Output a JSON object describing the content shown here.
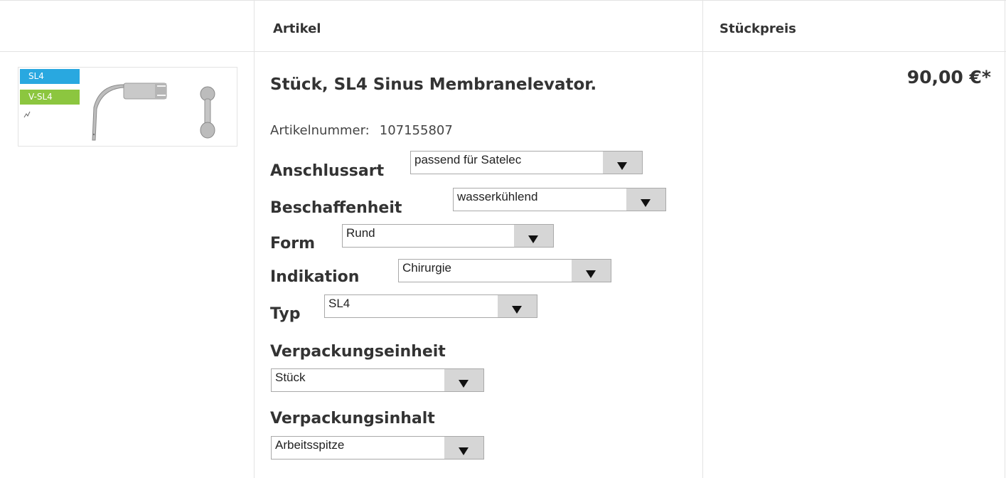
{
  "table": {
    "headers": {
      "artikel": "Artikel",
      "stueckpreis": "Stückpreis"
    }
  },
  "product": {
    "image": {
      "tag_sl4": "SL4",
      "tag_vsl4": "V-SL4",
      "tag_sl4_color": "#29a8e0",
      "tag_vsl4_color": "#8cc63f"
    },
    "title": "Stück, SL4 Sinus Membranelevator.",
    "sku_label": "Artikelnummer:",
    "sku_value": "107155807",
    "price": "90,00 €*",
    "options": [
      {
        "label": "Anschlussart",
        "value": "passend für Satelec"
      },
      {
        "label": "Beschaffenheit",
        "value": "wasserkühlend"
      },
      {
        "label": "Form",
        "value": "Rund"
      },
      {
        "label": "Indikation",
        "value": "Chirurgie"
      },
      {
        "label": "Typ",
        "value": "SL4"
      },
      {
        "label": "Verpackungseinheit",
        "value": "Stück"
      },
      {
        "label": "Verpackungsinhalt",
        "value": "Arbeitsspitze"
      }
    ]
  }
}
